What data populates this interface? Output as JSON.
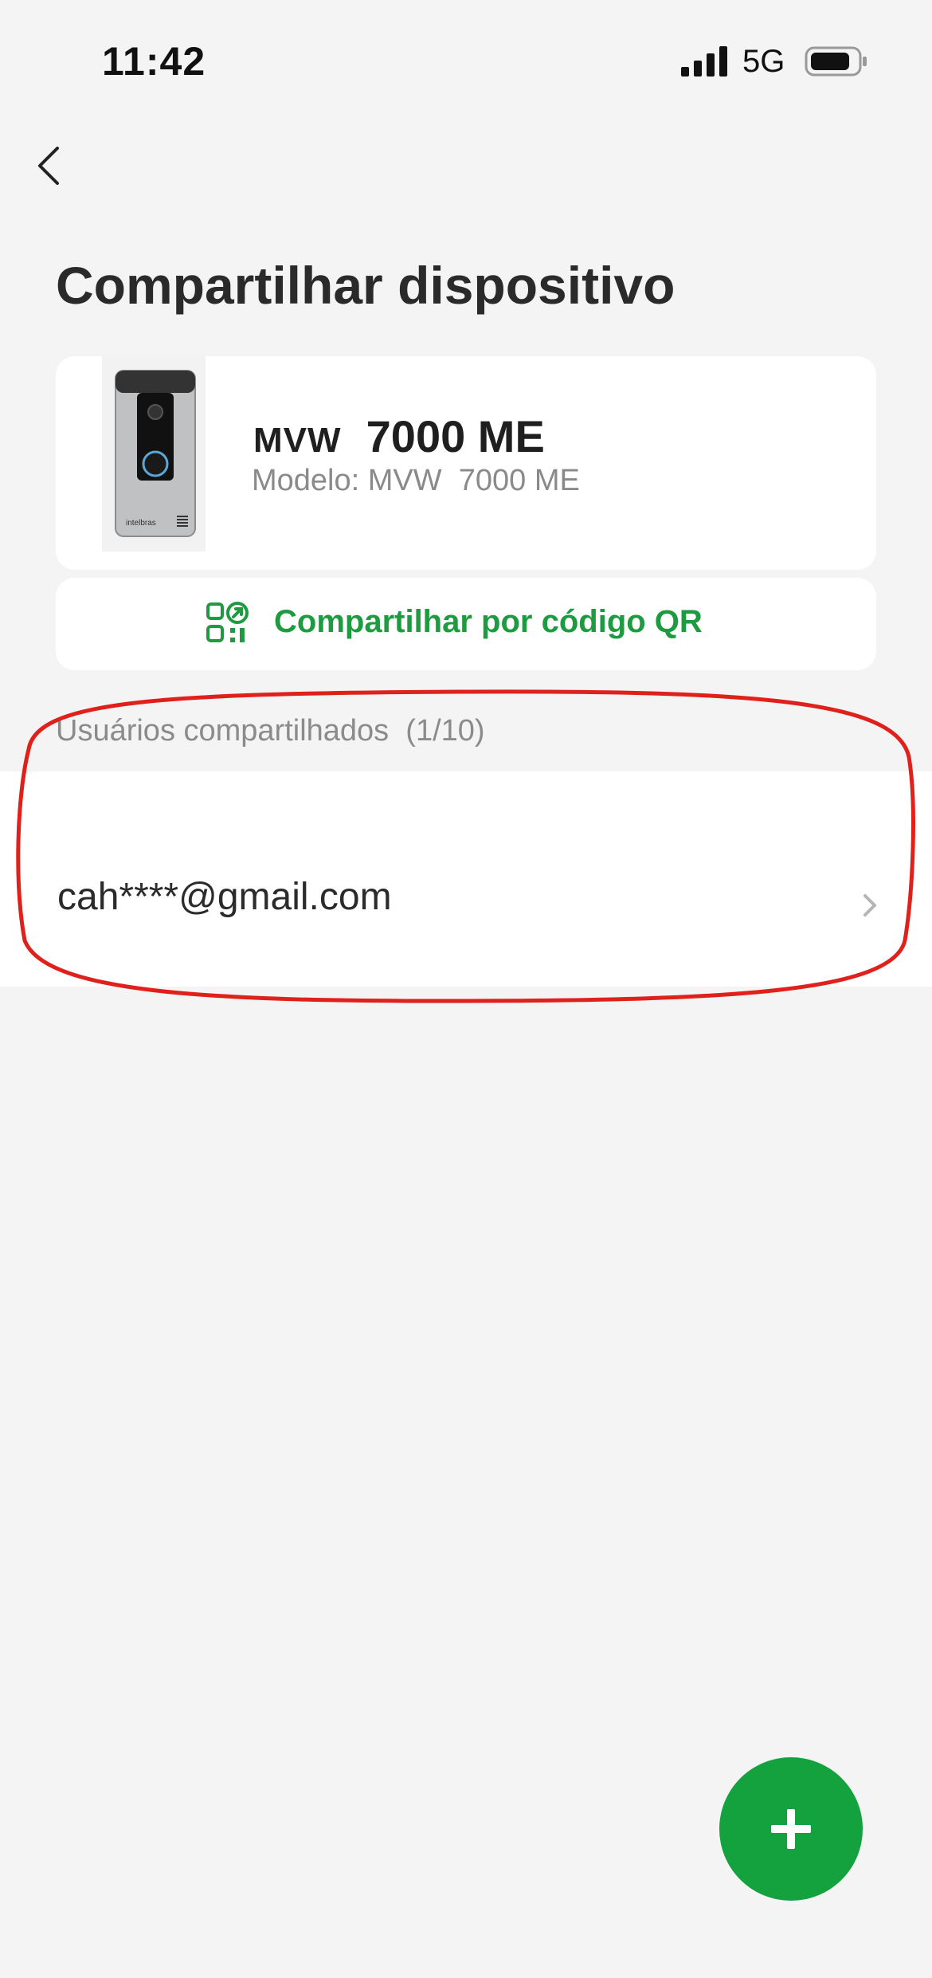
{
  "status_bar": {
    "time": "11:42",
    "network": "5G"
  },
  "header": {
    "title": "Compartilhar dispositivo"
  },
  "device": {
    "name_prefix": "MVW",
    "name_suffix": "7000 ME",
    "model_label": "Modelo: MVW  7000 ME",
    "brand_on_image": "intelbras"
  },
  "qr_share": {
    "label": "Compartilhar por código QR"
  },
  "shared_users": {
    "header": "Usuários compartilhados  (1/10)",
    "users": [
      {
        "email": "cah****@gmail.com"
      }
    ]
  },
  "colors": {
    "accent": "#14a23f",
    "qr_text": "#1e9a40",
    "highlight": "#e0201b",
    "background": "#f4f4f4"
  }
}
